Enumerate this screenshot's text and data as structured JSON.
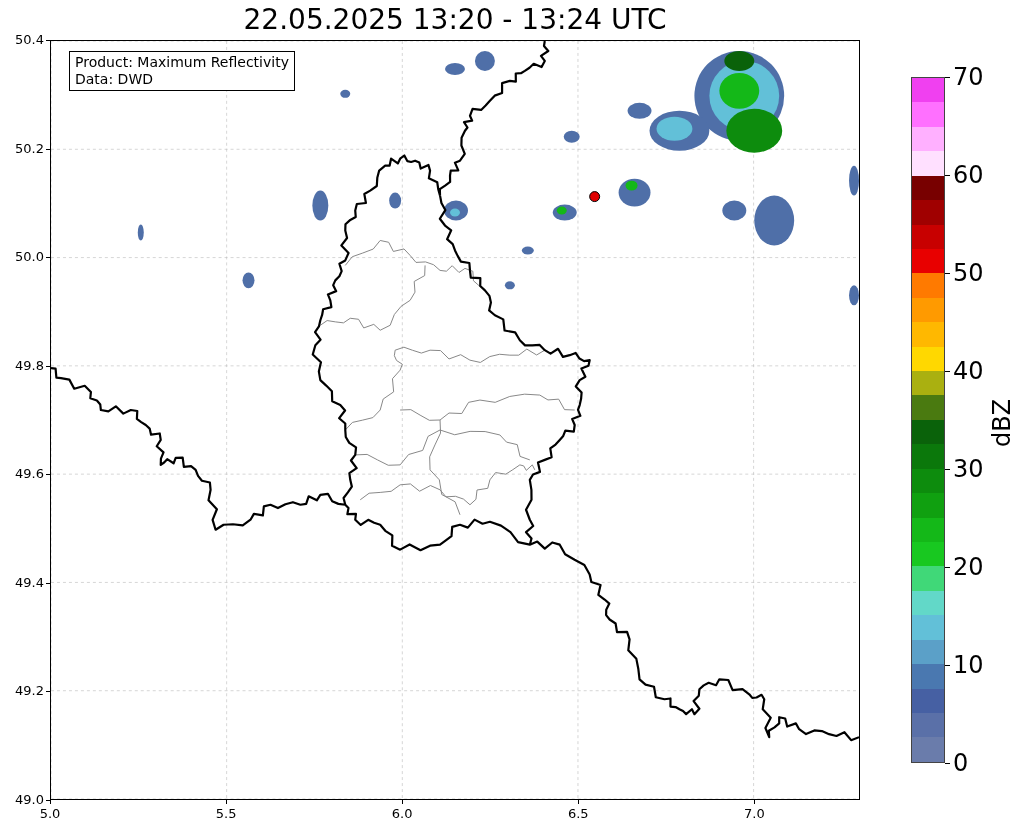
{
  "title": "22.05.2025 13:20 - 13:24 UTC",
  "info_box": [
    "Product: Maximum Reflectivity",
    "Data: DWD"
  ],
  "map": {
    "y_ticks": [
      "50.4",
      "50.2",
      "50.0",
      "49.8",
      "49.6",
      "49.4",
      "49.2",
      "49.0"
    ],
    "x_ticks": [
      "5.0",
      "5.5",
      "6.0",
      "6.5",
      "7.0"
    ]
  },
  "colorbar": {
    "label": "dBZ",
    "ticks": [
      "70",
      "60",
      "50",
      "40",
      "30",
      "20",
      "10",
      "0"
    ],
    "segments": [
      {
        "color": "#f040f0"
      },
      {
        "color": "#ff70ff"
      },
      {
        "color": "#ffb0ff"
      },
      {
        "color": "#ffe0ff"
      },
      {
        "color": "#780000"
      },
      {
        "color": "#a00000"
      },
      {
        "color": "#c80000"
      },
      {
        "color": "#e80000"
      },
      {
        "color": "#ff7a00"
      },
      {
        "color": "#ff9a00"
      },
      {
        "color": "#ffb800"
      },
      {
        "color": "#ffd800"
      },
      {
        "color": "#aab010"
      },
      {
        "color": "#4a7a10"
      },
      {
        "color": "#0a620a"
      },
      {
        "color": "#0b780b"
      },
      {
        "color": "#0d8c0d"
      },
      {
        "color": "#10a010"
      },
      {
        "color": "#14b818"
      },
      {
        "color": "#18c820"
      },
      {
        "color": "#40d878"
      },
      {
        "color": "#62d8c8"
      },
      {
        "color": "#62c0d8"
      },
      {
        "color": "#5ba0c8"
      },
      {
        "color": "#4a78b0"
      },
      {
        "color": "#4660a3"
      },
      {
        "color": "#5a70a8"
      },
      {
        "color": "#6a7cab"
      }
    ]
  }
}
